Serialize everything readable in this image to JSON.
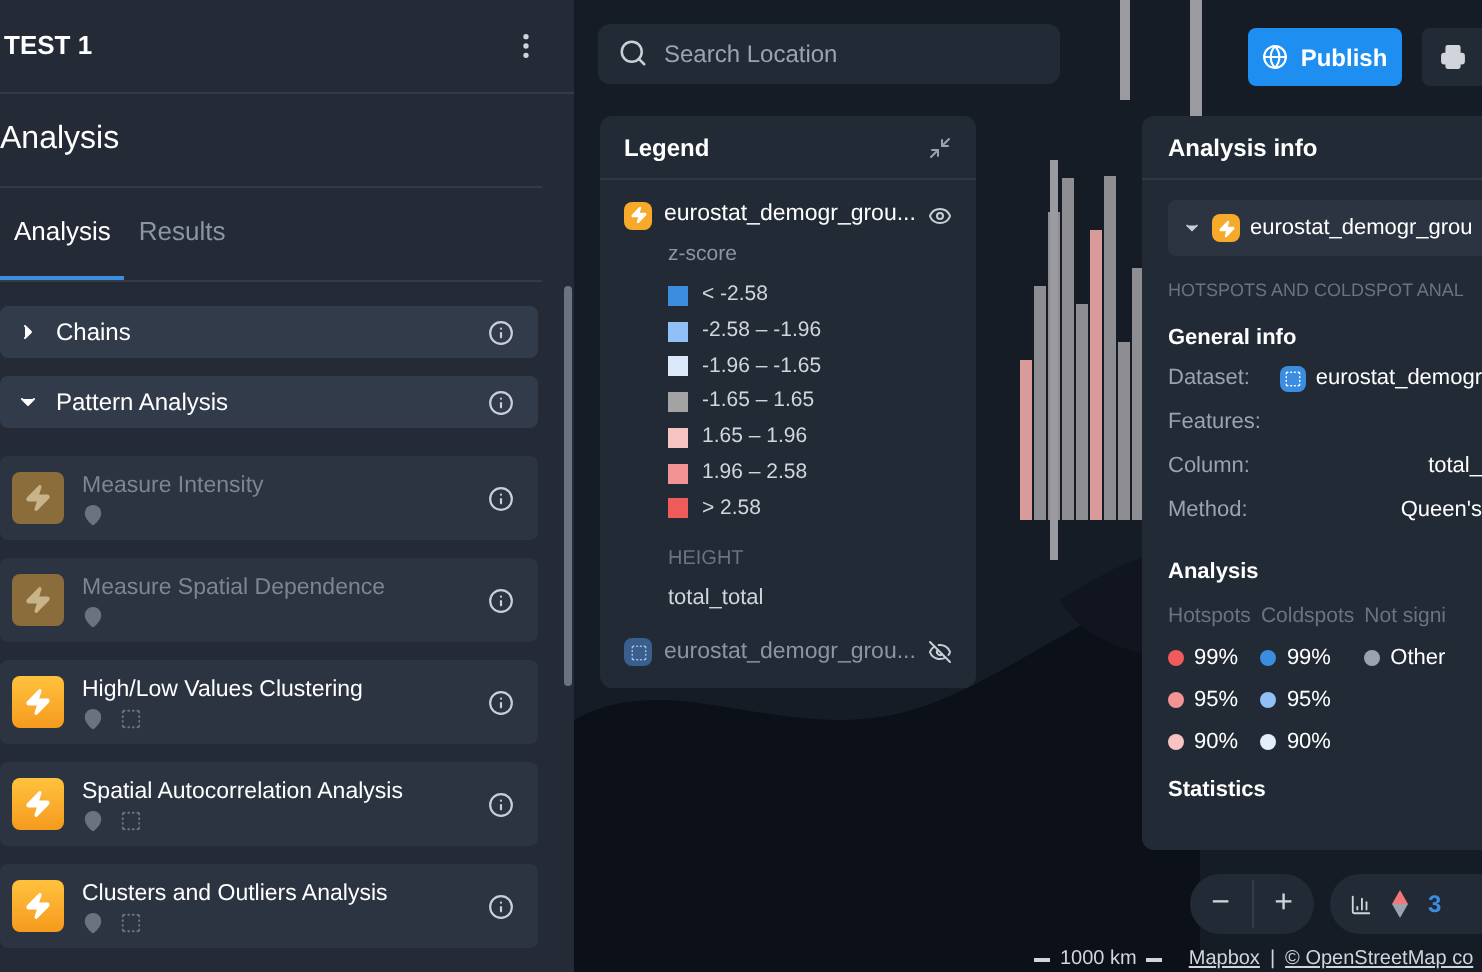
{
  "project": {
    "title": "TEST 1"
  },
  "sidebar": {
    "title": "Analysis",
    "tabs": [
      {
        "label": "Analysis",
        "selected": true
      },
      {
        "label": "Results",
        "selected": false
      }
    ],
    "groups": [
      {
        "label": "Chains",
        "expanded": false
      },
      {
        "label": "Pattern Analysis",
        "expanded": true
      }
    ],
    "tools": [
      {
        "name": "Measure Intensity",
        "disabled": true,
        "polygon_support": false
      },
      {
        "name": "Measure Spatial Dependence",
        "disabled": true,
        "polygon_support": false
      },
      {
        "name": "High/Low Values Clustering",
        "disabled": false,
        "polygon_support": true
      },
      {
        "name": "Spatial Autocorrelation Analysis",
        "disabled": false,
        "polygon_support": true
      },
      {
        "name": "Clusters and Outliers Analysis",
        "disabled": false,
        "polygon_support": true
      }
    ]
  },
  "search": {
    "placeholder": "Search Location"
  },
  "publish_button": "Publish",
  "legend": {
    "title": "Legend",
    "layers": [
      {
        "kind": "analysis",
        "name": "eurostat_demogr_grou...",
        "visible": true,
        "color_title": "z-score",
        "classes": [
          {
            "label": "< -2.58",
            "color": "#3b8de0"
          },
          {
            "label": "-2.58 – -1.96",
            "color": "#90c0f5"
          },
          {
            "label": "-1.96 – -1.65",
            "color": "#dbe9fb"
          },
          {
            "label": "-1.65 – 1.65",
            "color": "#a3a3a3"
          },
          {
            "label": "1.65 – 1.96",
            "color": "#f7c3c3"
          },
          {
            "label": "1.96 – 2.58",
            "color": "#f29494"
          },
          {
            "label": "> 2.58",
            "color": "#ef5a5a"
          }
        ],
        "height_title": "HEIGHT",
        "height_value": "total_total"
      },
      {
        "kind": "dataset",
        "name": "eurostat_demogr_grou...",
        "visible": false
      }
    ]
  },
  "analysis_info": {
    "title": "Analysis info",
    "selected_layer": "eurostat_demogr_grou",
    "section": "HOTSPOTS AND COLDSPOT ANAL",
    "general_title": "General info",
    "general": [
      {
        "label": "Dataset:",
        "value": "eurostat_demogr",
        "kind": "dataset"
      },
      {
        "label": "Features:",
        "kind": "text"
      },
      {
        "label": "Column:",
        "value": "total_",
        "kind": "text"
      },
      {
        "label": "Method:",
        "value": "Queen's",
        "kind": "text"
      }
    ],
    "analysis_title": "Analysis",
    "columns": [
      {
        "heading": "Hotspots",
        "items": [
          {
            "label": "99%",
            "color": "#ef5a5a"
          },
          {
            "label": "95%",
            "color": "#f29494"
          },
          {
            "label": "90%",
            "color": "#f7c3c3"
          }
        ]
      },
      {
        "heading": "Coldspots",
        "items": [
          {
            "label": "99%",
            "color": "#3b8de0"
          },
          {
            "label": "95%",
            "color": "#90c0f5"
          },
          {
            "label": "90%",
            "color": "#e3eefb"
          }
        ]
      },
      {
        "heading": "Not signi",
        "items": [
          {
            "label": "Other",
            "color": "#9ca3af"
          }
        ]
      }
    ],
    "statistics_title": "Statistics"
  },
  "map_controls": {
    "zoom_out": "−",
    "zoom_in": "+",
    "view_mode": "3"
  },
  "footer": {
    "scale": "1000 km",
    "attribution_links": [
      "Mapbox",
      "© OpenStreetMap co"
    ],
    "separator": "|"
  }
}
